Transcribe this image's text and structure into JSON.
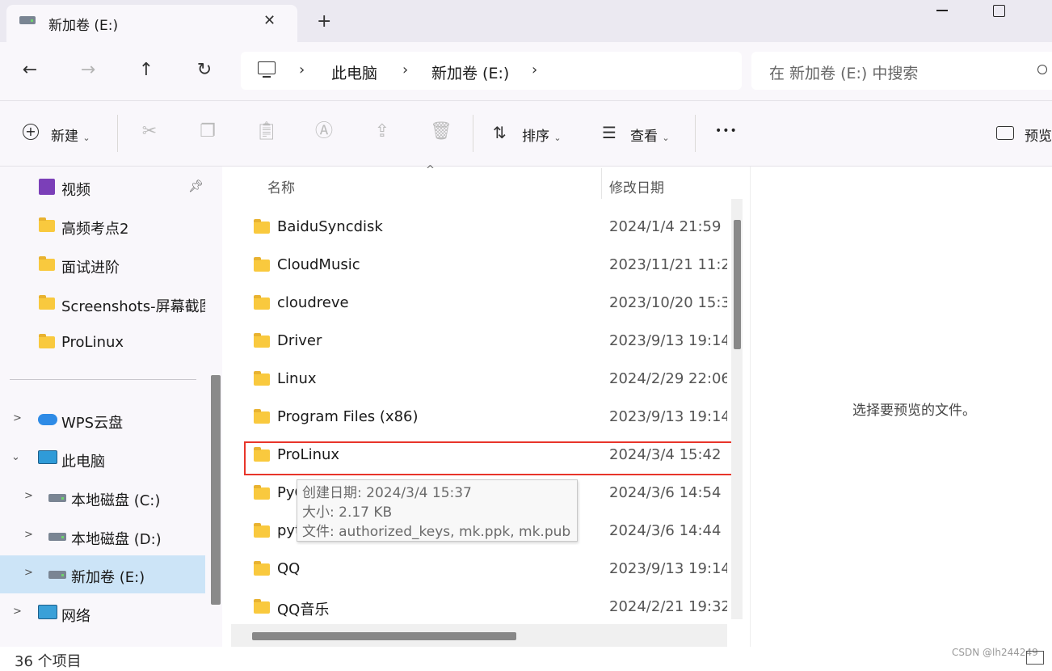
{
  "tab": {
    "title": "新加卷 (E:)",
    "close_glyph": "✕",
    "new_tab_glyph": "+"
  },
  "nav": {
    "back_glyph": "←",
    "forward_glyph": "→",
    "up_glyph": "↑",
    "refresh_glyph": "↻",
    "breadcrumbs": [
      "此电脑",
      "新加卷 (E:)"
    ],
    "separator": "›",
    "search_placeholder": "在 新加卷 (E:) 中搜索"
  },
  "toolbar": {
    "new_label": "新建",
    "sort_label": "排序",
    "view_label": "查看",
    "more_glyph": "•••",
    "preview_label": "预览"
  },
  "sidebar": {
    "quick_items": [
      {
        "label": "视频",
        "icon": "video-folder-icon",
        "pinned": true
      },
      {
        "label": "高频考点2",
        "icon": "folder-icon"
      },
      {
        "label": "面试进阶",
        "icon": "folder-icon"
      },
      {
        "label": "Screenshots-屏幕截图",
        "icon": "folder-icon"
      },
      {
        "label": "ProLinux",
        "icon": "folder-icon"
      }
    ],
    "tree_items": [
      {
        "label": "WPS云盘",
        "icon": "cloud-icon",
        "expanded": false
      },
      {
        "label": "此电脑",
        "icon": "pc-icon",
        "expanded": true
      },
      {
        "label": "本地磁盘 (C:)",
        "icon": "drive-icon",
        "expanded": false
      },
      {
        "label": "本地磁盘 (D:)",
        "icon": "drive-icon",
        "expanded": false
      },
      {
        "label": "新加卷 (E:)",
        "icon": "drive-icon",
        "expanded": false,
        "selected": true
      },
      {
        "label": "网络",
        "icon": "network-icon",
        "expanded": false
      }
    ]
  },
  "filelist": {
    "columns": {
      "name": "名称",
      "date": "修改日期"
    },
    "rows": [
      {
        "name": "BaiduSyncdisk",
        "date": "2024/1/4 21:59"
      },
      {
        "name": "CloudMusic",
        "date": "2023/11/21 11:2"
      },
      {
        "name": "cloudreve",
        "date": "2023/10/20 15:3"
      },
      {
        "name": "Driver",
        "date": "2023/9/13 19:14"
      },
      {
        "name": "Linux",
        "date": "2024/2/29 22:06"
      },
      {
        "name": "Program Files (x86)",
        "date": "2023/9/13 19:14"
      },
      {
        "name": "ProLinux",
        "date": "2024/3/4 15:42",
        "highlighted": true
      },
      {
        "name": "PyCharm",
        "date": "2024/3/6 14:54"
      },
      {
        "name": "python",
        "date": "2024/3/6 14:44"
      },
      {
        "name": "QQ",
        "date": "2023/9/13 19:14"
      },
      {
        "name": "QQ音乐",
        "date": "2024/2/21 19:32"
      }
    ]
  },
  "tooltip": {
    "created": "创建日期: 2024/3/4 15:37",
    "size": "大小: 2.17 KB",
    "files": "文件: authorized_keys, mk.ppk, mk.pub"
  },
  "preview": {
    "message": "选择要预览的文件。"
  },
  "status": {
    "item_count": "36 个项目"
  },
  "watermark": "CSDN @lh244249",
  "colors": {
    "accent_selected": "#cce4f7",
    "highlight_border": "#e8352a",
    "folder": "#f9c93e"
  }
}
